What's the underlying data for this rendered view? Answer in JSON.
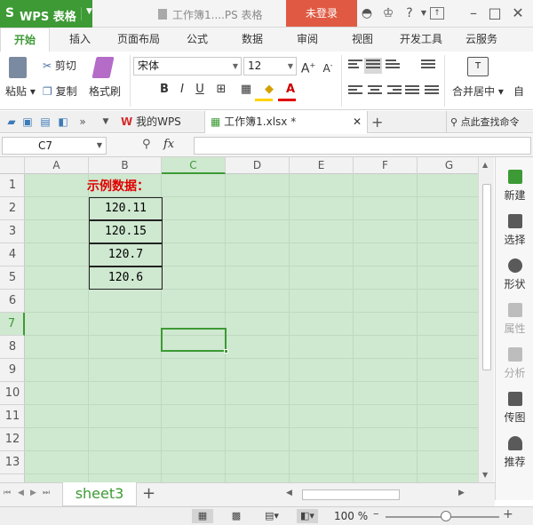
{
  "titlebar": {
    "app_name": "WPS 表格",
    "document_title": "工作簿1....PS 表格",
    "login_label": "未登录",
    "icons": [
      "skin-icon",
      "shirt-icon",
      "help-icon",
      "restore-icon",
      "minimize-icon",
      "close-icon"
    ],
    "help_glyph": "?",
    "minimize_glyph": "–",
    "close_glyph": "✕"
  },
  "ribbon_tabs": [
    "开始",
    "插入",
    "页面布局",
    "公式",
    "数据",
    "审阅",
    "视图",
    "开发工具",
    "云服务"
  ],
  "ribbon": {
    "paste": "粘贴",
    "cut": "剪切",
    "copy": "复制",
    "format_painter": "格式刷",
    "font_name": "宋体",
    "font_size": "12",
    "bold": "B",
    "italic": "I",
    "underline": "U",
    "merge_center": "合并居中",
    "auto_wrap": "自",
    "grow_font": "A",
    "shrink_font": "A"
  },
  "docbar": {
    "tabs": [
      {
        "label": "我的WPS"
      },
      {
        "label": "工作簿1.xlsx *"
      }
    ],
    "new_tab": "+",
    "search_label": "点此查找命令"
  },
  "formula_bar": {
    "name_box": "C7",
    "fx_label": "fx",
    "formula": ""
  },
  "grid": {
    "columns": [
      "A",
      "B",
      "C",
      "D",
      "E",
      "F",
      "G"
    ],
    "rows": [
      "1",
      "2",
      "3",
      "4",
      "5",
      "6",
      "7",
      "8",
      "9",
      "10",
      "11",
      "12",
      "13"
    ],
    "selected_cell": "C7",
    "label_cell": {
      "ref": "B1",
      "text": "示例数据："
    },
    "data_cells": [
      {
        "ref": "B2",
        "value": "120.11"
      },
      {
        "ref": "B3",
        "value": "120.15"
      },
      {
        "ref": "B4",
        "value": "120.7"
      },
      {
        "ref": "B5",
        "value": "120.6"
      }
    ]
  },
  "side_panel": [
    {
      "label": "新建",
      "enabled": true
    },
    {
      "label": "选择",
      "enabled": true
    },
    {
      "label": "形状",
      "enabled": true
    },
    {
      "label": "属性",
      "enabled": false
    },
    {
      "label": "分析",
      "enabled": false
    },
    {
      "label": "传图",
      "enabled": true
    },
    {
      "label": "推荐",
      "enabled": true
    }
  ],
  "sheet_bar": {
    "sheet_tab": "sheet3",
    "add_sheet": "+"
  },
  "status_bar": {
    "zoom": "100 %",
    "zoom_out": "–",
    "zoom_in": "+"
  },
  "colors": {
    "accent": "#3d9a35",
    "login_red": "#e05a43",
    "grid_green": "#cfe8d0",
    "label_red": "#e00000"
  }
}
